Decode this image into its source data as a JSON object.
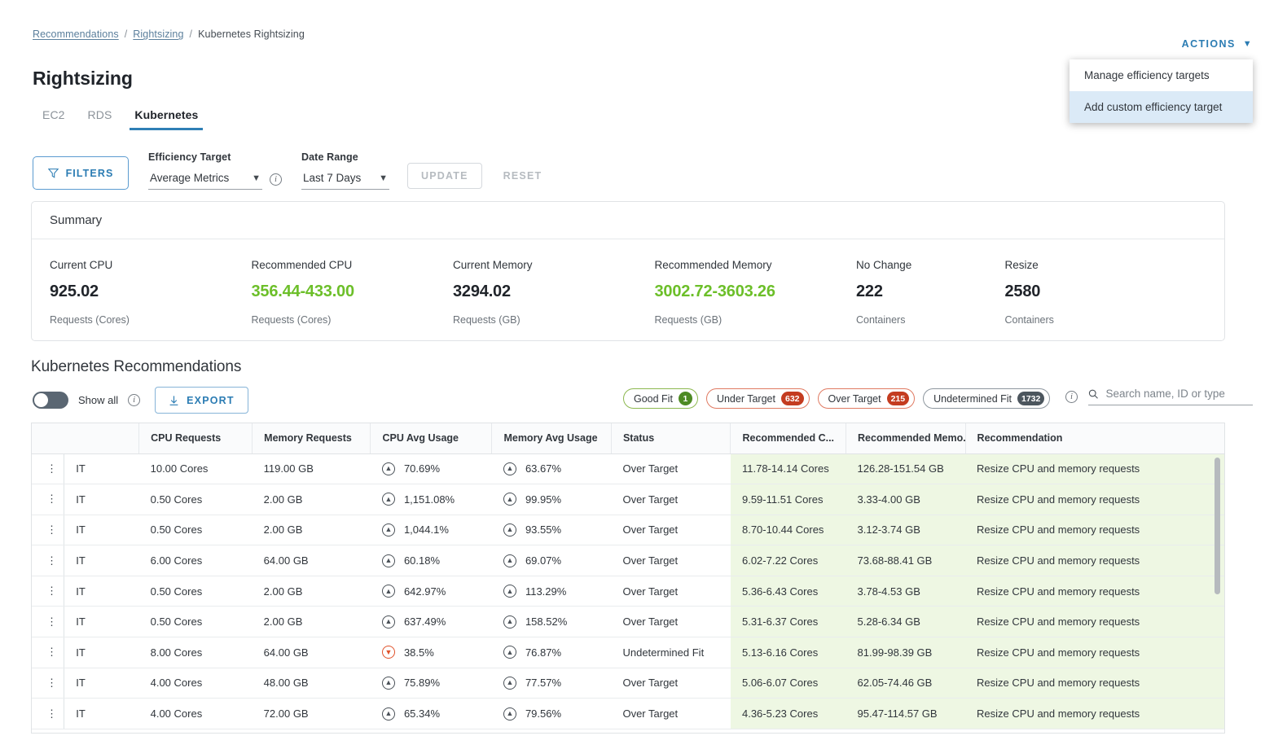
{
  "breadcrumb": {
    "items": [
      "Recommendations",
      "Rightsizing",
      "Kubernetes Rightsizing"
    ]
  },
  "header": {
    "title": "Rightsizing",
    "actions_label": "ACTIONS",
    "actions_chevron": "chevron-down-icon"
  },
  "actions_menu": {
    "items": [
      {
        "label": "Manage efficiency targets",
        "selected": false
      },
      {
        "label": "Add custom efficiency target",
        "selected": true
      }
    ]
  },
  "tabs": [
    {
      "label": "EC2",
      "active": false
    },
    {
      "label": "RDS",
      "active": false
    },
    {
      "label": "Kubernetes",
      "active": true
    }
  ],
  "filter_bar": {
    "filters_label": "FILTERS",
    "filters_icon": "funnel-icon",
    "efficiency_target": {
      "label": "Efficiency Target",
      "value": "Average Metrics"
    },
    "efficiency_info_icon": "info-icon",
    "date_range": {
      "label": "Date Range",
      "value": "Last 7 Days"
    },
    "update_label": "UPDATE",
    "reset_label": "RESET"
  },
  "summary": {
    "title": "Summary",
    "metrics": [
      {
        "label": "Current CPU",
        "value": "925.02",
        "unit": "Requests (Cores)",
        "green": false
      },
      {
        "label": "Recommended CPU",
        "value": "356.44-433.00",
        "unit": "Requests (Cores)",
        "green": true
      },
      {
        "label": "Current Memory",
        "value": "3294.02",
        "unit": "Requests (GB)",
        "green": false
      },
      {
        "label": "Recommended Memory",
        "value": "3002.72-3603.26",
        "unit": "Requests (GB)",
        "green": true
      },
      {
        "label": "No Change",
        "value": "222",
        "unit": "Containers",
        "green": false
      },
      {
        "label": "Resize",
        "value": "2580",
        "unit": "Containers",
        "green": false
      }
    ]
  },
  "recommendations": {
    "title": "Kubernetes Recommendations",
    "show_all_label": "Show all",
    "show_all_info_icon": "info-icon",
    "show_all_on": false,
    "export_label": "EXPORT",
    "export_icon": "download-icon",
    "chips": [
      {
        "label": "Good Fit",
        "count": "1",
        "style": "good"
      },
      {
        "label": "Under Target",
        "count": "632",
        "style": "red"
      },
      {
        "label": "Over Target",
        "count": "215",
        "style": "red"
      },
      {
        "label": "Undetermined Fit",
        "count": "1732",
        "style": "gray"
      }
    ],
    "chips_info_icon": "info-icon",
    "search": {
      "icon": "search-icon",
      "placeholder": "Search name, ID or type",
      "value": ""
    }
  },
  "table": {
    "columns": [
      "",
      "",
      "CPU Requests",
      "Memory Requests",
      "CPU Avg Usage",
      "Memory Avg Usage",
      "Status",
      "Recommended C...",
      "Recommended Memo...",
      "Recommendation"
    ],
    "sorted_column_index": 7,
    "sort_icon": "arrow-down-icon",
    "row_menu_icon": "kebab-menu-icon",
    "rows": [
      {
        "name": "IT",
        "cpu_requests": "10.00 Cores",
        "memory_requests": "119.00 GB",
        "cpu_usage": "70.69%",
        "cpu_dir": "up",
        "mem_usage": "63.67%",
        "mem_dir": "up",
        "status": "Over Target",
        "rec_cpu": "11.78-14.14 Cores",
        "rec_mem": "126.28-151.54 GB",
        "recommendation": "Resize CPU and memory requests"
      },
      {
        "name": "IT",
        "cpu_requests": "0.50 Cores",
        "memory_requests": "2.00 GB",
        "cpu_usage": "1,151.08%",
        "cpu_dir": "up",
        "mem_usage": "99.95%",
        "mem_dir": "up",
        "status": "Over Target",
        "rec_cpu": "9.59-11.51 Cores",
        "rec_mem": "3.33-4.00 GB",
        "recommendation": "Resize CPU and memory requests"
      },
      {
        "name": "IT",
        "cpu_requests": "0.50 Cores",
        "memory_requests": "2.00 GB",
        "cpu_usage": "1,044.1%",
        "cpu_dir": "up",
        "mem_usage": "93.55%",
        "mem_dir": "up",
        "status": "Over Target",
        "rec_cpu": "8.70-10.44 Cores",
        "rec_mem": "3.12-3.74 GB",
        "recommendation": "Resize CPU and memory requests"
      },
      {
        "name": "IT",
        "cpu_requests": "6.00 Cores",
        "memory_requests": "64.00 GB",
        "cpu_usage": "60.18%",
        "cpu_dir": "up",
        "mem_usage": "69.07%",
        "mem_dir": "up",
        "status": "Over Target",
        "rec_cpu": "6.02-7.22 Cores",
        "rec_mem": "73.68-88.41 GB",
        "recommendation": "Resize CPU and memory requests"
      },
      {
        "name": "IT",
        "cpu_requests": "0.50 Cores",
        "memory_requests": "2.00 GB",
        "cpu_usage": "642.97%",
        "cpu_dir": "up",
        "mem_usage": "113.29%",
        "mem_dir": "up",
        "status": "Over Target",
        "rec_cpu": "5.36-6.43 Cores",
        "rec_mem": "3.78-4.53 GB",
        "recommendation": "Resize CPU and memory requests"
      },
      {
        "name": "IT",
        "cpu_requests": "0.50 Cores",
        "memory_requests": "2.00 GB",
        "cpu_usage": "637.49%",
        "cpu_dir": "up",
        "mem_usage": "158.52%",
        "mem_dir": "up",
        "status": "Over Target",
        "rec_cpu": "5.31-6.37 Cores",
        "rec_mem": "5.28-6.34 GB",
        "recommendation": "Resize CPU and memory requests"
      },
      {
        "name": "IT",
        "cpu_requests": "8.00 Cores",
        "memory_requests": "64.00 GB",
        "cpu_usage": "38.5%",
        "cpu_dir": "down",
        "mem_usage": "76.87%",
        "mem_dir": "up",
        "status": "Undetermined Fit",
        "rec_cpu": "5.13-6.16 Cores",
        "rec_mem": "81.99-98.39 GB",
        "recommendation": "Resize CPU and memory requests"
      },
      {
        "name": "IT",
        "cpu_requests": "4.00 Cores",
        "memory_requests": "48.00 GB",
        "cpu_usage": "75.89%",
        "cpu_dir": "up",
        "mem_usage": "77.57%",
        "mem_dir": "up",
        "status": "Over Target",
        "rec_cpu": "5.06-6.07 Cores",
        "rec_mem": "62.05-74.46 GB",
        "recommendation": "Resize CPU and memory requests"
      },
      {
        "name": "IT",
        "cpu_requests": "4.00 Cores",
        "memory_requests": "72.00 GB",
        "cpu_usage": "65.34%",
        "cpu_dir": "up",
        "mem_usage": "79.56%",
        "mem_dir": "up",
        "status": "Over Target",
        "rec_cpu": "4.36-5.23 Cores",
        "rec_mem": "95.47-114.57 GB",
        "recommendation": "Resize CPU and memory requests"
      }
    ]
  },
  "colors": {
    "accent": "#2b7cb3",
    "green": "#6cbf29",
    "row_green_bg": "#eef7e3",
    "red": "#c43c20"
  }
}
